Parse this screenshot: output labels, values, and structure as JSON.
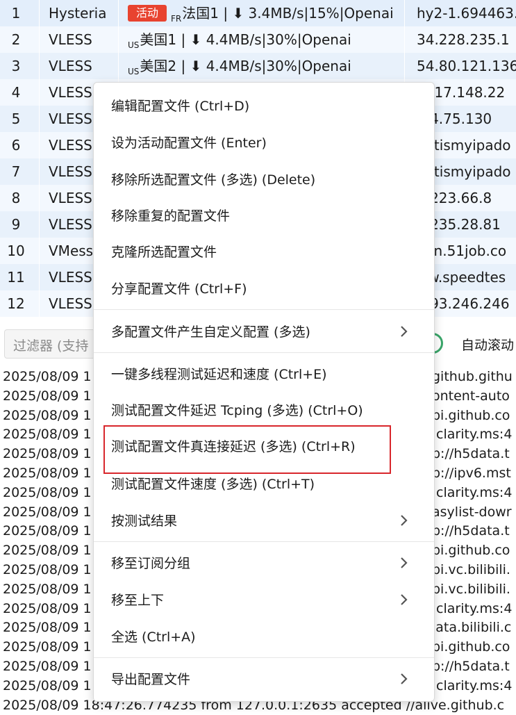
{
  "table": {
    "rows": [
      {
        "index": "1",
        "type": "Hysteria",
        "badge": "活动",
        "cc": "FR",
        "remark": "法国1 | ⬇ 3.4MB/s|15%|Openai",
        "address": "hy2-1.694463..."
      },
      {
        "index": "2",
        "type": "VLESS",
        "cc": "US",
        "remark": "美国1 | ⬇ 4.4MB/s|30%|Openai",
        "address": "34.228.235.1"
      },
      {
        "index": "3",
        "type": "VLESS",
        "cc": "US",
        "remark": "美国2 | ⬇ 4.4MB/s|30%|Openai",
        "address": "54.80.121.136"
      },
      {
        "index": "4",
        "type": "VLESS",
        "cc": "",
        "remark": "",
        "address": ".4.17.148.22"
      },
      {
        "index": "5",
        "type": "VLESS",
        "cc": "",
        "remark": "",
        "address": ".04.75.130"
      },
      {
        "index": "6",
        "type": "VLESS",
        "cc": "",
        "remark": "",
        "address": "hatismyipado"
      },
      {
        "index": "7",
        "type": "VLESS",
        "cc": "",
        "remark": "",
        "address": "hatismyipado"
      },
      {
        "index": "8",
        "type": "VLESS",
        "cc": "",
        "remark": "",
        "address": "6.223.66.8"
      },
      {
        "index": "9",
        "type": "VLESS",
        "cc": "",
        "remark": "",
        "address": "7.235.28.81"
      },
      {
        "index": "10",
        "type": "VMess",
        "cc": "",
        "remark": "",
        "address": "vpn.51job.co"
      },
      {
        "index": "11",
        "type": "VLESS",
        "cc": "",
        "remark": "",
        "address": "ww.speedtes"
      },
      {
        "index": "12",
        "type": "VLESS",
        "cc": "",
        "remark": "",
        "address": "0.93.246.246"
      }
    ]
  },
  "filter": {
    "placeholder": "过滤器 (支持"
  },
  "auto_scroll": {
    "label": "自动滚动"
  },
  "log": {
    "lines": [
      {
        "ts": "2025/08/09 1",
        "tail": "github.githu"
      },
      {
        "ts": "2025/08/09 1",
        "tail": "ontent-auto"
      },
      {
        "ts": "2025/08/09 1",
        "tail": "pi.github.co"
      },
      {
        "ts": "2025/08/09 1",
        "tail": ".clarity.ms:4"
      },
      {
        "ts": "2025/08/09 1",
        "tail": "p://h5data.t"
      },
      {
        "ts": "2025/08/09 1",
        "tail": "p://ipv6.mst"
      },
      {
        "ts": "2025/08/09 1",
        "tail": ".clarity.ms:4"
      },
      {
        "ts": "2025/08/09 1",
        "tail": "asylist-dowr"
      },
      {
        "ts": "2025/08/09 1",
        "tail": "p://h5data.t"
      },
      {
        "ts": "2025/08/09 1",
        "tail": "pi.github.co"
      },
      {
        "ts": "2025/08/09 1",
        "tail": "pi.vc.bilibili."
      },
      {
        "ts": "2025/08/09 1",
        "tail": "pi.vc.bilibili."
      },
      {
        "ts": "2025/08/09 1",
        "tail": ".clarity.ms:4"
      },
      {
        "ts": "2025/08/09 1",
        "tail": "lata.bilibili.c"
      },
      {
        "ts": "2025/08/09 1",
        "tail": "pi.github.co"
      },
      {
        "ts": "2025/08/09 1",
        "tail": "p://h5data.t"
      },
      {
        "ts": "2025/08/09 1",
        "tail": ".clarity.ms:4"
      },
      {
        "ts": "2025/08/09 18:47:26.774235 from 127.0.0.1:2635 accepted //alive.github.c",
        "tail": ""
      }
    ]
  },
  "menu": {
    "items": [
      {
        "label": "编辑配置文件 (Ctrl+D)",
        "submenu": false
      },
      {
        "label": "设为活动配置文件 (Enter)",
        "submenu": false
      },
      {
        "label": "移除所选配置文件 (多选) (Delete)",
        "submenu": false
      },
      {
        "label": "移除重复的配置文件",
        "submenu": false
      },
      {
        "label": "克隆所选配置文件",
        "submenu": false
      },
      {
        "label": "分享配置文件 (Ctrl+F)",
        "submenu": false
      },
      {
        "label": "多配置文件产生自定义配置 (多选)",
        "submenu": true
      },
      {
        "label": "一键多线程测试延迟和速度 (Ctrl+E)",
        "submenu": false
      },
      {
        "label": "测试配置文件延迟 Tcping (多选) (Ctrl+O)",
        "submenu": false
      },
      {
        "label": "测试配置文件真连接延迟 (多选) (Ctrl+R)",
        "submenu": false,
        "highlighted": true
      },
      {
        "label": "测试配置文件速度 (多选) (Ctrl+T)",
        "submenu": false
      },
      {
        "label": "按测试结果",
        "submenu": true
      },
      {
        "label": "移至订阅分组",
        "submenu": true
      },
      {
        "label": "移至上下",
        "submenu": true
      },
      {
        "label": "全选 (Ctrl+A)",
        "submenu": false
      },
      {
        "label": "导出配置文件",
        "submenu": true
      }
    ]
  },
  "colors": {
    "badge": "#e8432f",
    "highlight": "#d8262b",
    "toggle": "#3aa66a"
  }
}
